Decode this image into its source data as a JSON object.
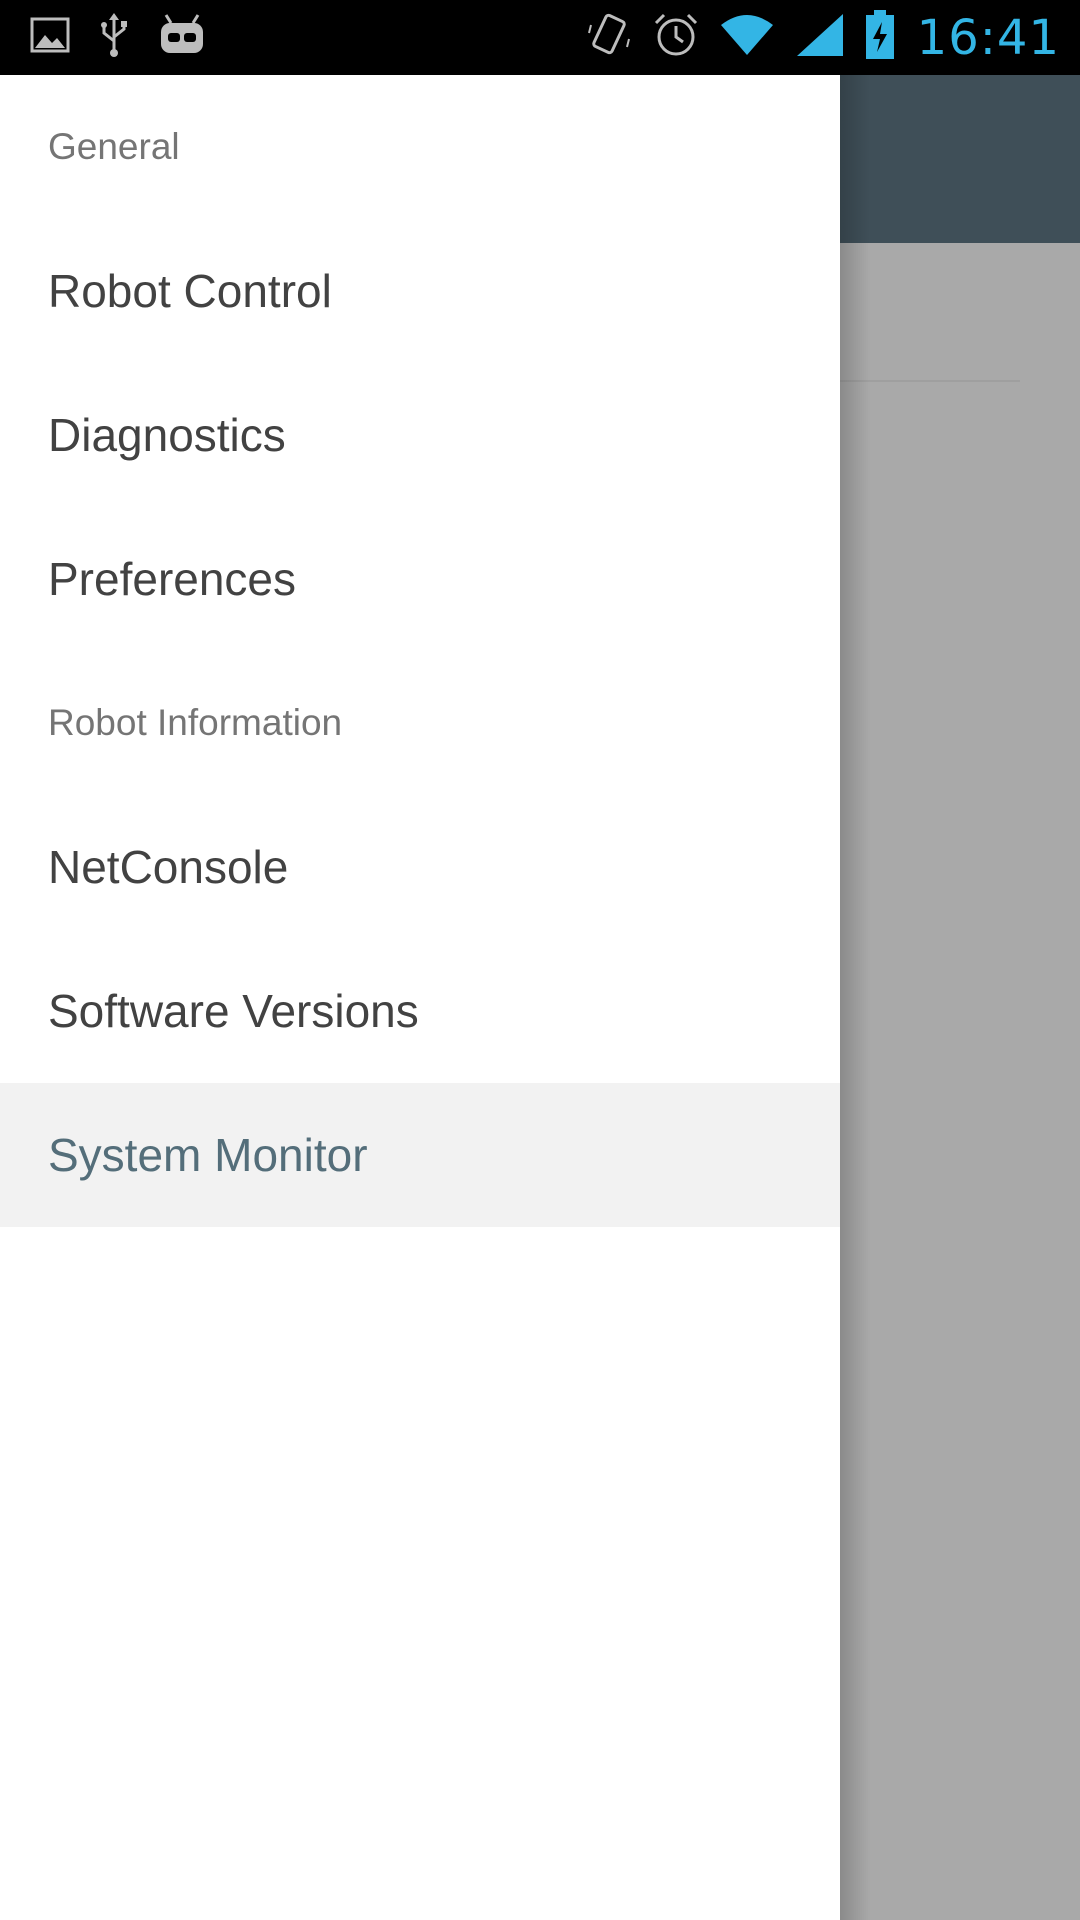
{
  "status_bar": {
    "left_icons": [
      "image-icon",
      "usb-icon",
      "cyanogenmod-icon"
    ],
    "right_icons": [
      "vibrate-icon",
      "alarm-icon",
      "wifi-icon",
      "signal-icon",
      "battery-charging-icon"
    ],
    "time": "16:41",
    "time_color": "#33b5e5"
  },
  "app_bar": {
    "color": "#3f4f58"
  },
  "drawer": {
    "sections": [
      {
        "header": "General",
        "items": [
          {
            "label": "Robot Control",
            "active": false
          },
          {
            "label": "Diagnostics",
            "active": false
          },
          {
            "label": "Preferences",
            "active": false
          }
        ]
      },
      {
        "header": "Robot Information",
        "items": [
          {
            "label": "NetConsole",
            "active": false
          },
          {
            "label": "Software Versions",
            "active": false
          },
          {
            "label": "System Monitor",
            "active": true
          }
        ]
      }
    ],
    "active_color": "#546e7a"
  }
}
